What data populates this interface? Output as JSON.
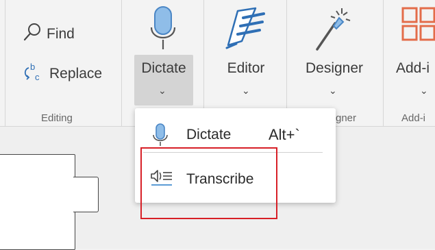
{
  "ribbon": {
    "editing": {
      "find_label": "Find",
      "replace_label": "Replace",
      "group_label": "Editing"
    },
    "dictate": {
      "label": "Dictate"
    },
    "editor": {
      "label": "Editor"
    },
    "designer": {
      "label": "Designer",
      "group_label": "gner"
    },
    "addins": {
      "label": "Add-i",
      "group_label": "Add-i"
    }
  },
  "dictate_menu": {
    "items": [
      {
        "label": "Dictate",
        "shortcut": "Alt+`",
        "icon": "microphone-icon"
      },
      {
        "label": "Transcribe",
        "icon": "transcribe-icon"
      }
    ]
  },
  "colors": {
    "accent_blue": "#5b9bd5",
    "highlight_red": "#d71f26",
    "addins_orange": "#e36c4a"
  }
}
